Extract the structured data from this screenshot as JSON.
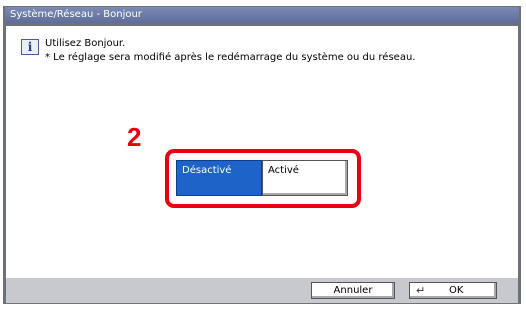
{
  "window": {
    "title": "Système/Réseau - Bonjour"
  },
  "message": {
    "icon": "info-icon",
    "line1": "Utilisez Bonjour.",
    "line2": "* Le réglage sera modifié après le redémarrage du système ou du réseau."
  },
  "step_marker": "2",
  "options": {
    "off_label": "Désactivé",
    "on_label": "Activé",
    "selected": "Désactivé"
  },
  "footer": {
    "cancel_label": "Annuler",
    "ok_label": "OK",
    "ok_icon": "enter-icon"
  },
  "colors": {
    "selected_button": "#1d63c8",
    "highlight": "#e60012",
    "title_bar": "#6a79a6"
  }
}
